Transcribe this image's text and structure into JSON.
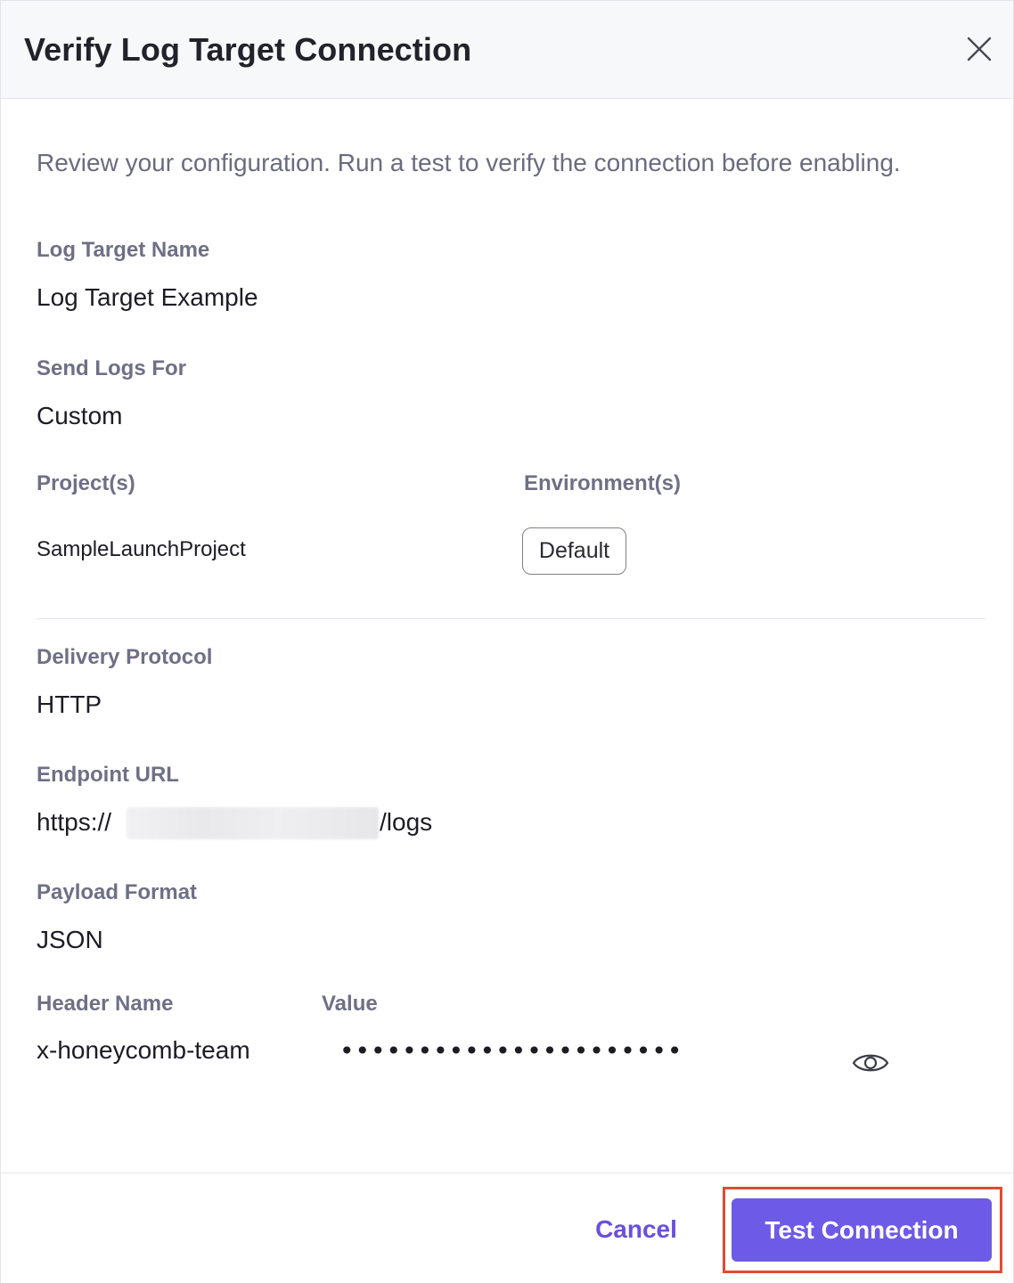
{
  "dialog": {
    "title": "Verify Log Target Connection",
    "intro": "Review your configuration. Run a test to verify the connection before enabling."
  },
  "fields": {
    "log_target_name": {
      "label": "Log Target Name",
      "value": "Log Target Example"
    },
    "send_logs_for": {
      "label": "Send Logs For",
      "value": "Custom"
    },
    "projects": {
      "label": "Project(s)",
      "value": "SampleLaunchProject"
    },
    "environments": {
      "label": "Environment(s)",
      "chip": "Default"
    },
    "delivery_protocol": {
      "label": "Delivery Protocol",
      "value": "HTTP"
    },
    "endpoint_url": {
      "label": "Endpoint URL",
      "prefix": "https://",
      "suffix": "/logs"
    },
    "payload_format": {
      "label": "Payload Format",
      "value": "JSON"
    },
    "header": {
      "name_label": "Header Name",
      "value_label": "Value",
      "name": "x-honeycomb-team",
      "masked_value": "••••••••••••••••••••••"
    }
  },
  "footer": {
    "cancel_label": "Cancel",
    "test_label": "Test Connection"
  },
  "icons": {
    "close": "close-icon",
    "reveal": "eye-icon"
  },
  "colors": {
    "accent": "#6d5ae6",
    "cancel_text": "#6a4fe0",
    "highlight_border": "#e24a33",
    "label": "#6f6f86"
  }
}
